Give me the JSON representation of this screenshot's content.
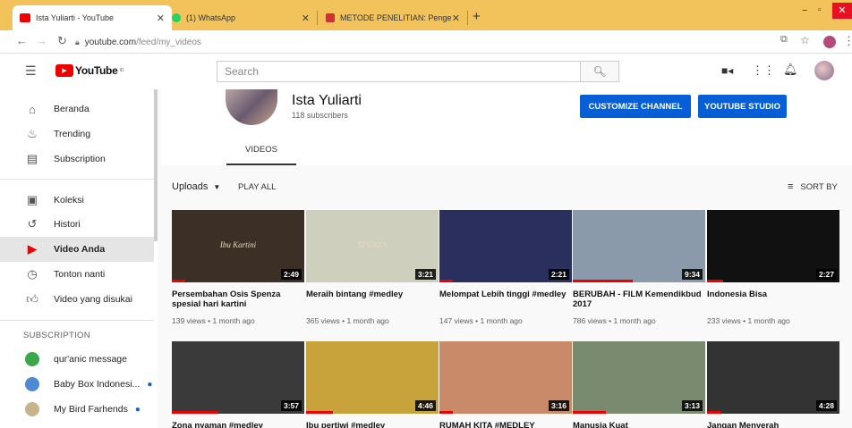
{
  "browser": {
    "tabs": [
      {
        "label": "Ista Yuliarti - YouTube",
        "active": true
      },
      {
        "label": "(1) WhatsApp",
        "active": false
      },
      {
        "label": "METODE PENELITIAN: Pengertian",
        "active": false
      }
    ],
    "new_tab": "+",
    "url_host": "youtube.com",
    "url_path": "/feed/my_videos"
  },
  "youtube": {
    "logo": "YouTube",
    "logo_region": "ID",
    "search_placeholder": "Search"
  },
  "sidebar": {
    "main": [
      {
        "label": "Beranda",
        "icon": "home-icon"
      },
      {
        "label": "Trending",
        "icon": "flame-icon"
      },
      {
        "label": "Subscription",
        "icon": "subscriptions-icon"
      }
    ],
    "library": [
      {
        "label": "Koleksi",
        "icon": "library-icon"
      },
      {
        "label": "Histori",
        "icon": "history-icon"
      },
      {
        "label": "Video Anda",
        "icon": "your-videos-icon",
        "active": true
      },
      {
        "label": "Tonton nanti",
        "icon": "clock-icon"
      },
      {
        "label": "Video yang disukai",
        "icon": "thumbs-up-icon"
      }
    ],
    "subscription_header": "SUBSCRIPTION",
    "subscriptions": [
      {
        "label": "qur'anic message",
        "color": "#3aa84a",
        "new": false
      },
      {
        "label": "Baby Box Indonesi...",
        "color": "#4d8ad2",
        "new": true
      },
      {
        "label": "My Bird Farhends",
        "color": "#c8b48a",
        "new": true
      }
    ]
  },
  "channel": {
    "name": "Ista Yuliarti",
    "subscribers": "118 subscribers",
    "customize_label": "CUSTOMIZE CHANNEL",
    "studio_label": "YOUTUBE STUDIO",
    "tab_videos": "VIDEOS"
  },
  "filters": {
    "uploads": "Uploads",
    "play_all": "PLAY ALL",
    "sort_by": "SORT BY"
  },
  "videos_row1": [
    {
      "title": "Persembahan Osis Spenza spesial hari kartini",
      "meta": "139 views • 1 month ago",
      "duration": "2:49",
      "thumb": "#3b2f26",
      "progress": 0.1,
      "caption": "Ibu Kartini"
    },
    {
      "title": "Meraih bintang #medley",
      "meta": "365 views • 1 month ago",
      "duration": "3:21",
      "thumb": "#cfcfbe",
      "progress": 0.0,
      "caption": "SPENZA"
    },
    {
      "title": "Melompat Lebih tinggi #medley",
      "meta": "147 views • 1 month ago",
      "duration": "2:21",
      "thumb": "#2a2f5e",
      "progress": 0.1
    },
    {
      "title": "BERUBAH - FILM Kemendikbud 2017",
      "meta": "786 views • 1 month ago",
      "duration": "9:34",
      "thumb": "#8a9aaa",
      "progress": 0.45
    },
    {
      "title": "Indonesia Bisa",
      "meta": "233 views • 1 month ago",
      "duration": "2:27",
      "thumb": "#111111",
      "progress": 0.12
    }
  ],
  "videos_row2": [
    {
      "title": "Zona nyaman #medley",
      "duration": "3:57",
      "thumb": "#3a3a3a",
      "progress": 0.35
    },
    {
      "title": "Ibu pertiwi #medley",
      "duration": "4:46",
      "thumb": "#c8a23a",
      "progress": 0.2
    },
    {
      "title": "RUMAH KITA #MEDLEY",
      "duration": "3:16",
      "thumb": "#c98a6a",
      "progress": 0.1
    },
    {
      "title": "Manusia Kuat",
      "duration": "3:13",
      "thumb": "#7a8a6e",
      "progress": 0.25
    },
    {
      "title": "Jangan Menyerah",
      "duration": "4:28",
      "thumb": "#333333",
      "progress": 0.1
    }
  ]
}
